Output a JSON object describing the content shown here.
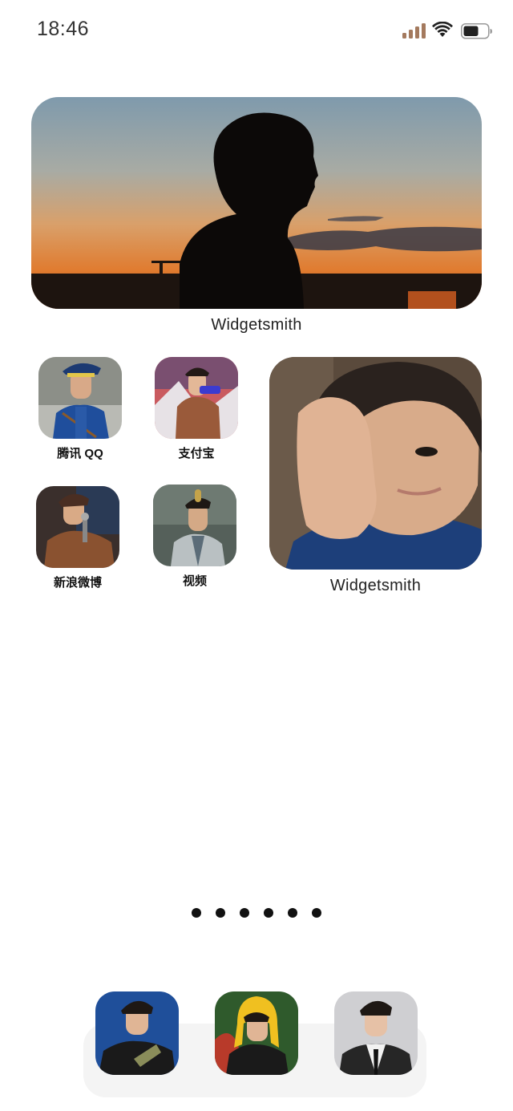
{
  "status_bar": {
    "time": "18:46",
    "icons": [
      "cellular-signal-icon",
      "wifi-icon",
      "battery-icon"
    ]
  },
  "widgets": [
    {
      "id": "wide",
      "label": "Widgetsmith",
      "image": "sunset-silhouette-photo"
    },
    {
      "id": "square",
      "label": "Widgetsmith",
      "image": "portrait-photo"
    }
  ],
  "apps": [
    {
      "label": "腾讯 QQ",
      "icon": "qq-app-photo-icon"
    },
    {
      "label": "支付宝",
      "icon": "alipay-app-photo-icon"
    },
    {
      "label": "新浪微博",
      "icon": "weibo-app-photo-icon"
    },
    {
      "label": "视频",
      "icon": "video-app-photo-icon"
    }
  ],
  "page_dots": {
    "count": 6
  },
  "dock": {
    "apps": [
      {
        "icon": "dock-app-1-photo-icon"
      },
      {
        "icon": "dock-app-2-photo-icon"
      },
      {
        "icon": "dock-app-3-photo-icon"
      }
    ]
  },
  "colors": {
    "background": "#ffffff",
    "dock": "#f4f4f4",
    "signal": "#a47a5e",
    "text": "#111111"
  }
}
